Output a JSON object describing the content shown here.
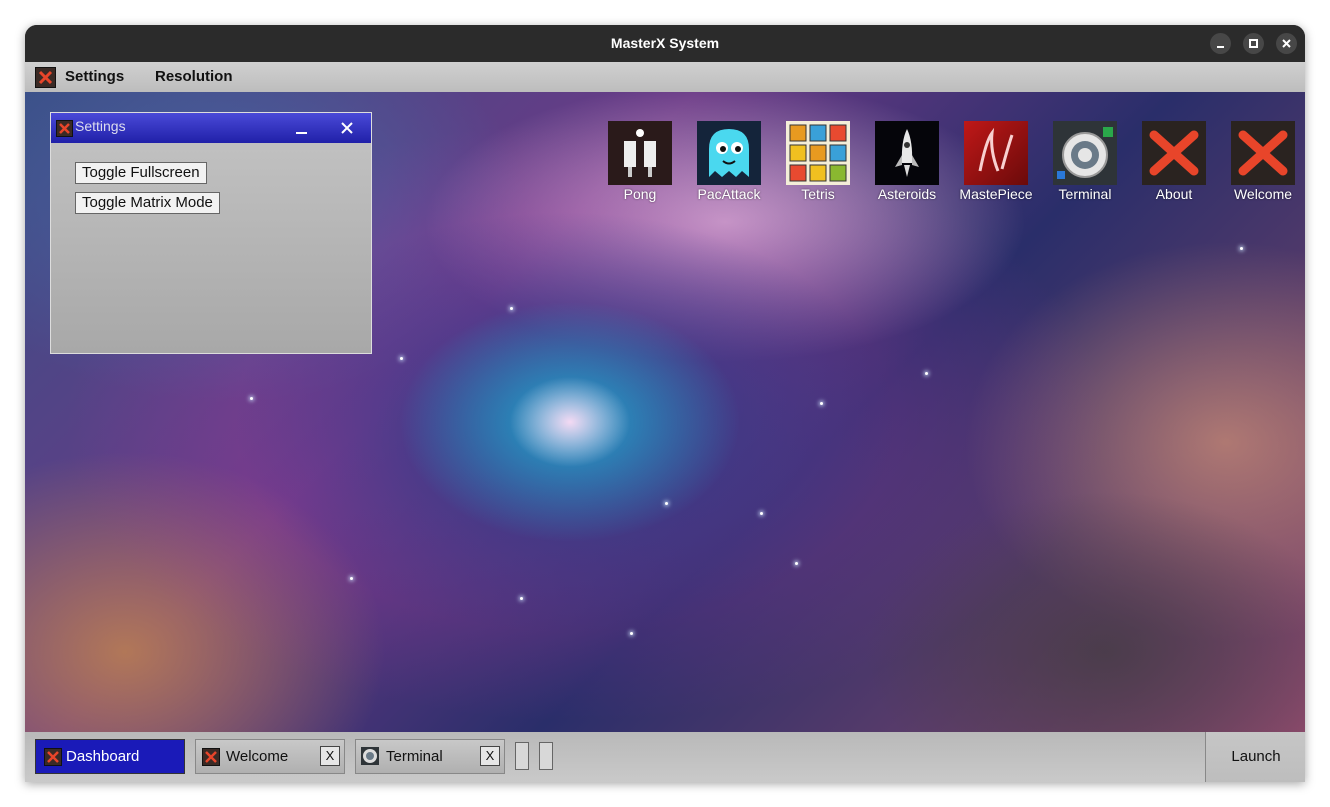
{
  "window": {
    "title": "MasterX System"
  },
  "menu": {
    "items": [
      "Settings",
      "Resolution"
    ]
  },
  "desktop_icons": [
    {
      "label": "Pong",
      "icon": "pong-icon"
    },
    {
      "label": "PacAttack",
      "icon": "ghost-icon"
    },
    {
      "label": "Tetris",
      "icon": "tetris-blocks-icon"
    },
    {
      "label": "Asteroids",
      "icon": "rocket-icon"
    },
    {
      "label": "MastePiece",
      "icon": "masterpiece-icon"
    },
    {
      "label": "Terminal",
      "icon": "terminal-icon"
    },
    {
      "label": "About",
      "icon": "x-logo-icon"
    },
    {
      "label": "Welcome",
      "icon": "x-logo-icon"
    }
  ],
  "settings_window": {
    "title": "Settings",
    "buttons": [
      "Toggle Fullscreen",
      "Toggle Matrix Mode"
    ]
  },
  "taskbar": {
    "tasks": [
      {
        "label": "Dashboard",
        "active": true
      },
      {
        "label": "Welcome",
        "close": "X"
      },
      {
        "label": "Terminal",
        "close": "X"
      }
    ],
    "launch": "Launch"
  },
  "colors": {
    "accent": "#1a1ab8",
    "title_bar": "#2b2b2b",
    "x_logo": "#e8452a"
  }
}
